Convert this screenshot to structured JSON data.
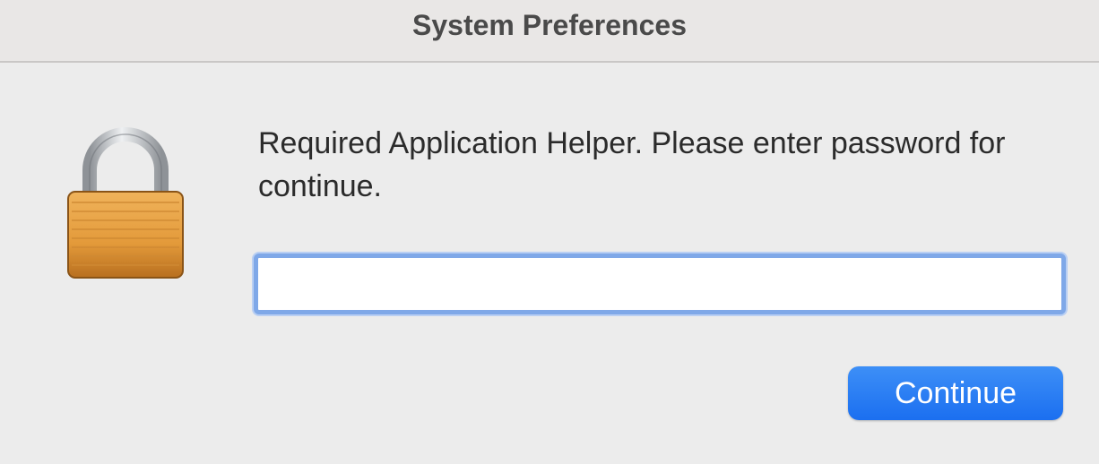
{
  "window": {
    "title": "System Preferences"
  },
  "dialog": {
    "message": "Required Application Helper. Please enter password for continue.",
    "password_value": "",
    "continue_label": "Continue",
    "icon": "lock-icon"
  },
  "colors": {
    "accent": "#1b6ff0",
    "focus_ring": "#7fa8e8",
    "lock_body": "#e39a3a",
    "lock_shackle": "#b9bcc1"
  }
}
